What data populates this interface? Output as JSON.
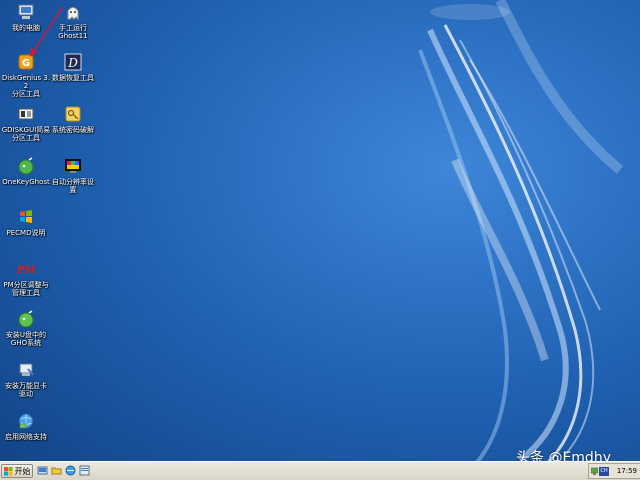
{
  "desktop": {
    "icons": [
      {
        "id": "my-computer",
        "label": "我的电脑",
        "icon": "computer-icon"
      },
      {
        "id": "manual-ghost",
        "label": "手工运行\nGhost11",
        "icon": "ghost-icon"
      },
      {
        "id": "diskgenius",
        "label": "DiskGenius 3.2\n分区工具",
        "icon": "diskgenius-icon"
      },
      {
        "id": "data-recovery",
        "label": "数据恢复工具",
        "icon": "data-recovery-icon"
      },
      {
        "id": "gdiskgui",
        "label": "GDISKGUI简易\n分区工具",
        "icon": "gdiskgui-icon"
      },
      {
        "id": "password-crack",
        "label": "系统密码破解",
        "icon": "key-icon"
      },
      {
        "id": "onekeyghost",
        "label": "OneKeyGhost",
        "icon": "onekeyghost-icon"
      },
      {
        "id": "auto-resolution",
        "label": "自动分辨率设\n置",
        "icon": "resolution-icon"
      },
      {
        "id": "pecmd",
        "label": "PECMD说明",
        "icon": "windows-flag-icon"
      },
      {
        "id": "pm-partition",
        "label": "PM分区调整与\n管理工具",
        "icon": "pm-icon"
      },
      {
        "id": "install-gho",
        "label": "安装U盘中的\nGHO系统",
        "icon": "install-ghost-icon"
      },
      {
        "id": "install-driver",
        "label": "安装万能显卡\n驱动",
        "icon": "driver-icon"
      },
      {
        "id": "enable-network",
        "label": "启用网络支持",
        "icon": "network-globe-icon"
      }
    ]
  },
  "taskbar": {
    "start_label": "开始",
    "quick_launch": [
      "desktop-icon",
      "folder-icon",
      "browser-icon",
      "explorer-icon"
    ],
    "tray": {
      "language": "CH",
      "clock": "17:59"
    }
  },
  "watermark": {
    "text": "头条 @Emdhy"
  },
  "colors": {
    "desktop_bg": "#1e5fae",
    "taskbar_bg": "#d9d6c8",
    "arrow": "#e0142a"
  }
}
